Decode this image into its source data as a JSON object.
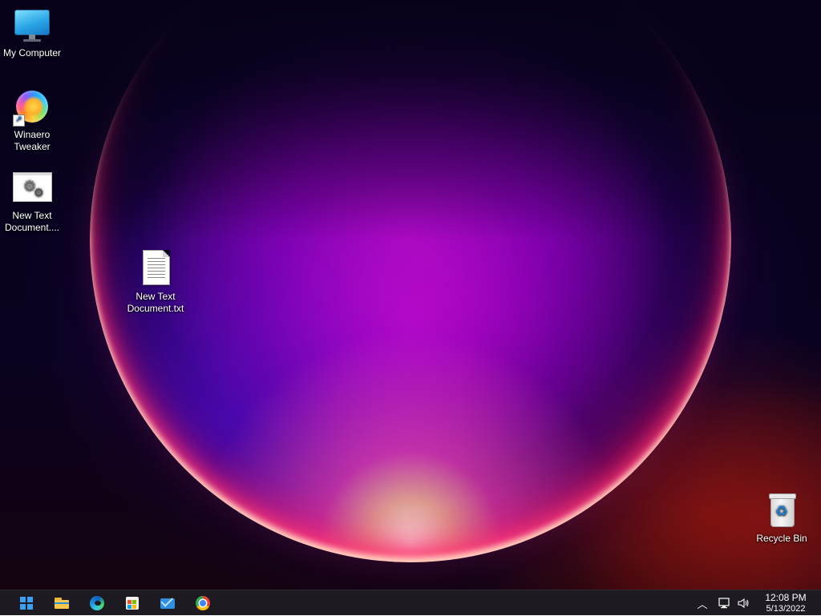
{
  "desktop": {
    "icons": [
      {
        "label": "My Computer",
        "icon": "monitor-icon"
      },
      {
        "label": "Winaero\nTweaker",
        "icon": "winaero-tweaker-icon"
      },
      {
        "label": "New Text\nDocument....",
        "icon": "gear-document-icon"
      },
      {
        "label": "New Text\nDocument.txt",
        "icon": "text-document-icon"
      },
      {
        "label": "Recycle Bin",
        "icon": "recycle-bin-icon"
      }
    ]
  },
  "taskbar": {
    "pinned": [
      {
        "name": "Start",
        "icon": "windows-logo-icon"
      },
      {
        "name": "File Explorer",
        "icon": "folder-icon"
      },
      {
        "name": "Microsoft Edge",
        "icon": "edge-icon"
      },
      {
        "name": "Microsoft Store",
        "icon": "store-icon"
      },
      {
        "name": "Mail",
        "icon": "mail-icon"
      },
      {
        "name": "Google Chrome",
        "icon": "chrome-icon"
      }
    ],
    "tray": {
      "overflow_icon": "chevron-up-icon",
      "network_icon": "network-icon",
      "volume_icon": "volume-icon",
      "time": "12:08 PM",
      "date": "5/13/2022"
    }
  },
  "colors": {
    "taskbar_bg": "#1d1a21",
    "accent": "#3aa0f3"
  }
}
